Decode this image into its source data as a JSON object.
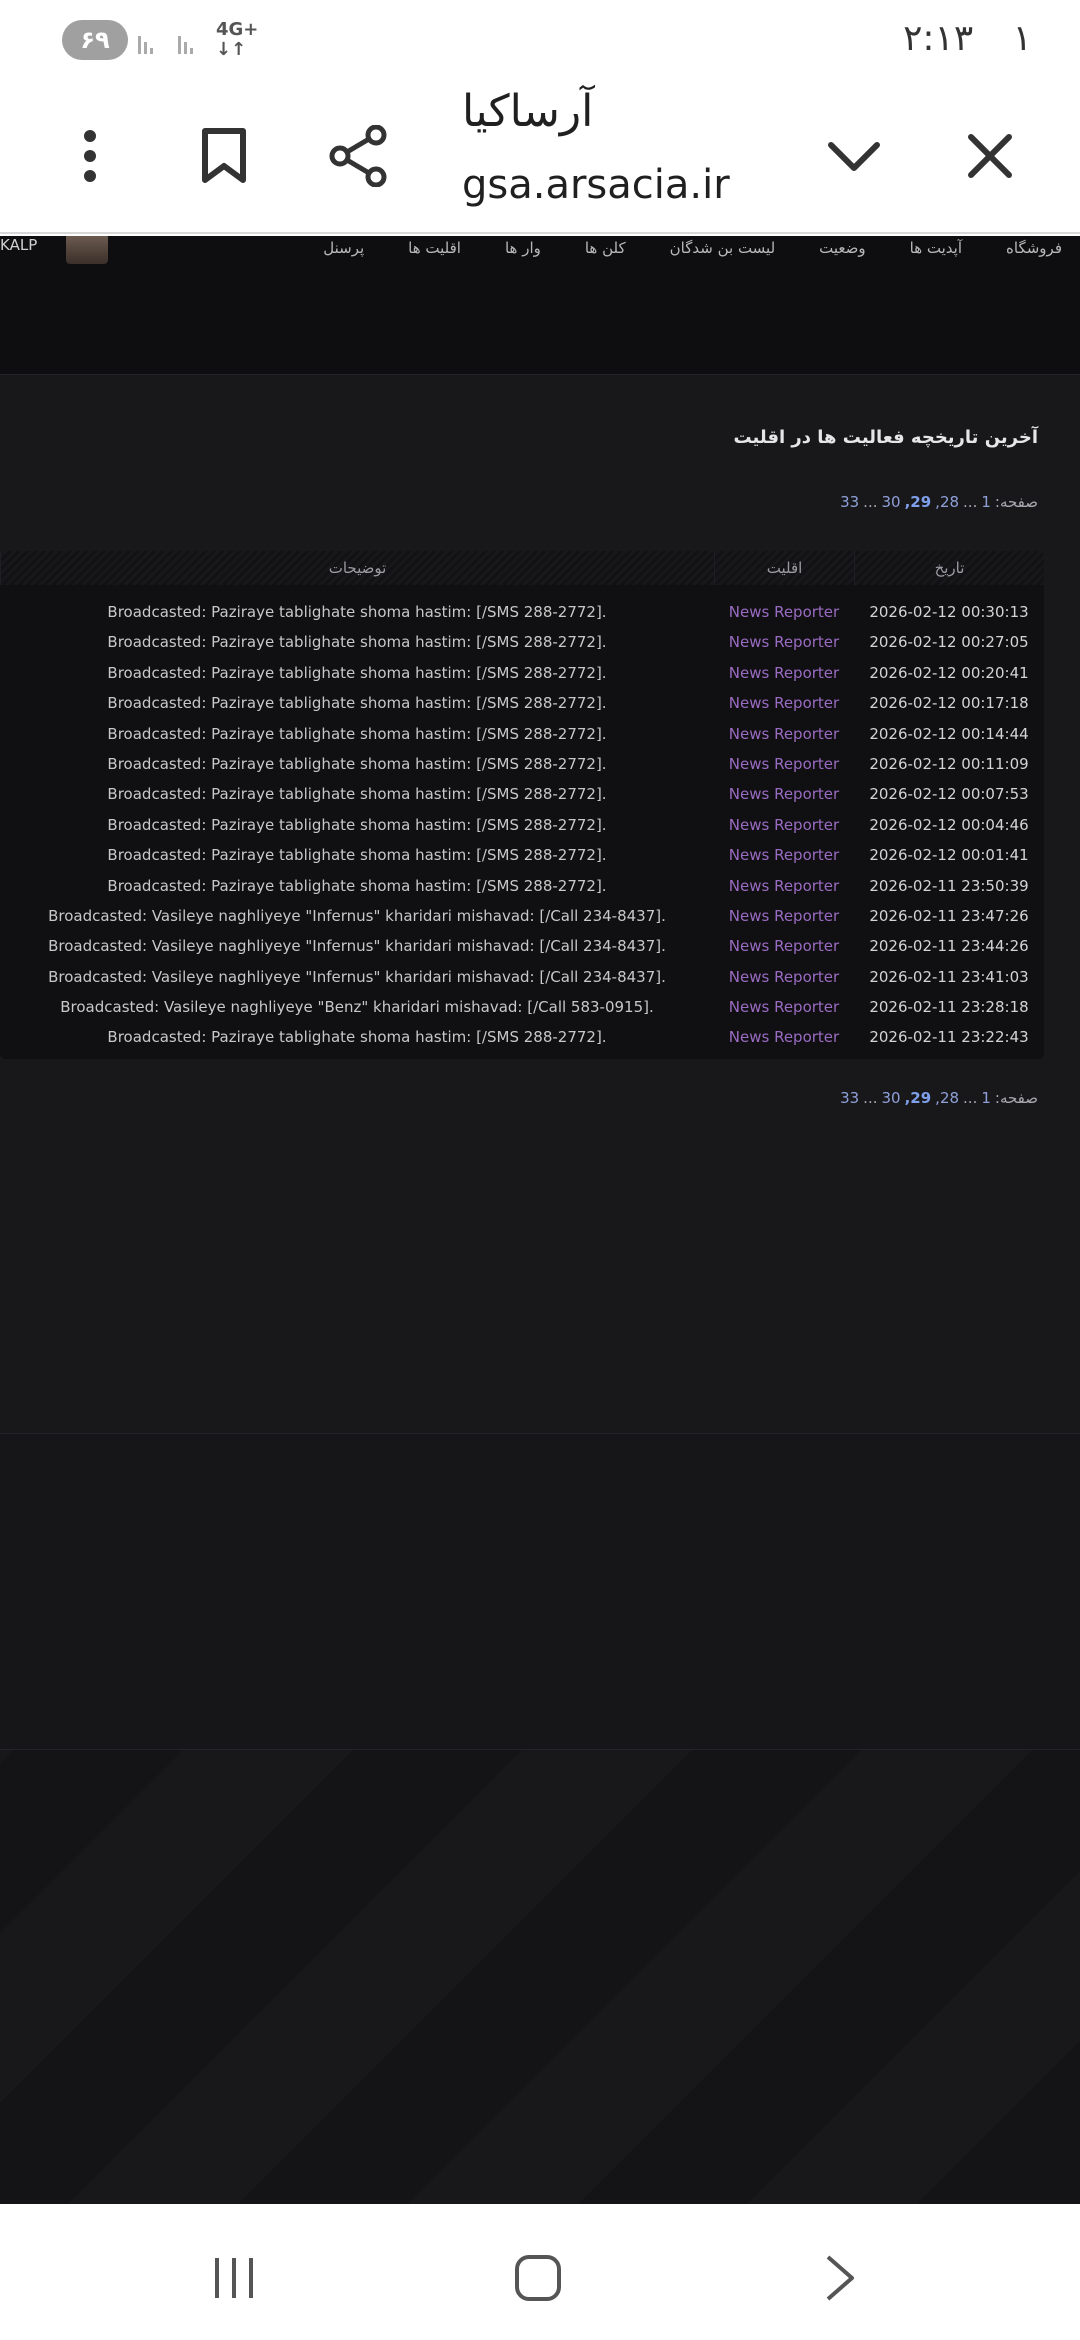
{
  "status_bar": {
    "time": "۲:۱۳",
    "notification_count": "۱",
    "battery": "۶۹",
    "network": "4G+"
  },
  "toolbar": {
    "title": "آرساکیا",
    "url": "gsa.arsacia.ir",
    "icons": [
      "close-icon",
      "chevron-down-icon",
      "share-icon",
      "bookmark-icon",
      "more-vert-icon"
    ]
  },
  "nav": {
    "items": [
      "پرسنل",
      "اقلیت ها",
      "وار ها",
      "کلن ها",
      "لیست بن شدگان",
      "وضعیت",
      "آپدیت ها",
      "فروشگاه"
    ],
    "username": "KALP"
  },
  "page": {
    "heading": "آخرین تاریخچه فعالیت ها در اقلیت",
    "pagination": {
      "label": "صفحه:",
      "first": "1",
      "ellipsis": "...",
      "pages": [
        "28,",
        "29,",
        "30"
      ],
      "current": "29,",
      "last": "33"
    }
  },
  "table": {
    "headers": {
      "date": "تاریخ",
      "faction": "اقلیت",
      "description": "توضیحات"
    },
    "rows": [
      {
        "date": "2026-02-12 00:30:13",
        "faction": "News Reporter",
        "description": "Broadcasted: Paziraye tablighate shoma hastim: [/SMS 288-2772]."
      },
      {
        "date": "2026-02-12 00:27:05",
        "faction": "News Reporter",
        "description": "Broadcasted: Paziraye tablighate shoma hastim: [/SMS 288-2772]."
      },
      {
        "date": "2026-02-12 00:20:41",
        "faction": "News Reporter",
        "description": "Broadcasted: Paziraye tablighate shoma hastim: [/SMS 288-2772]."
      },
      {
        "date": "2026-02-12 00:17:18",
        "faction": "News Reporter",
        "description": "Broadcasted: Paziraye tablighate shoma hastim: [/SMS 288-2772]."
      },
      {
        "date": "2026-02-12 00:14:44",
        "faction": "News Reporter",
        "description": "Broadcasted: Paziraye tablighate shoma hastim: [/SMS 288-2772]."
      },
      {
        "date": "2026-02-12 00:11:09",
        "faction": "News Reporter",
        "description": "Broadcasted: Paziraye tablighate shoma hastim: [/SMS 288-2772]."
      },
      {
        "date": "2026-02-12 00:07:53",
        "faction": "News Reporter",
        "description": "Broadcasted: Paziraye tablighate shoma hastim: [/SMS 288-2772]."
      },
      {
        "date": "2026-02-12 00:04:46",
        "faction": "News Reporter",
        "description": "Broadcasted: Paziraye tablighate shoma hastim: [/SMS 288-2772]."
      },
      {
        "date": "2026-02-12 00:01:41",
        "faction": "News Reporter",
        "description": "Broadcasted: Paziraye tablighate shoma hastim: [/SMS 288-2772]."
      },
      {
        "date": "2026-02-11 23:50:39",
        "faction": "News Reporter",
        "description": "Broadcasted: Paziraye tablighate shoma hastim: [/SMS 288-2772]."
      },
      {
        "date": "2026-02-11 23:47:26",
        "faction": "News Reporter",
        "description": "Broadcasted: Vasileye naghliyeye \"Infernus\" kharidari mishavad: [/Call 234-8437]."
      },
      {
        "date": "2026-02-11 23:44:26",
        "faction": "News Reporter",
        "description": "Broadcasted: Vasileye naghliyeye \"Infernus\" kharidari mishavad: [/Call 234-8437]."
      },
      {
        "date": "2026-02-11 23:41:03",
        "faction": "News Reporter",
        "description": "Broadcasted: Vasileye naghliyeye \"Infernus\" kharidari mishavad: [/Call 234-8437]."
      },
      {
        "date": "2026-02-11 23:28:18",
        "faction": "News Reporter",
        "description": "Broadcasted: Vasileye naghliyeye \"Benz\" kharidari mishavad: [/Call 583-0915]."
      },
      {
        "date": "2026-02-11 23:22:43",
        "faction": "News Reporter",
        "description": "Broadcasted: Paziraye tablighate shoma hastim: [/SMS 288-2772]."
      }
    ]
  },
  "colors": {
    "page_bg": "#151517",
    "faction_link": "#9a6bc2",
    "page_link": "#8fa0d8"
  },
  "system_nav": [
    "recents-icon",
    "home-icon",
    "back-icon"
  ]
}
